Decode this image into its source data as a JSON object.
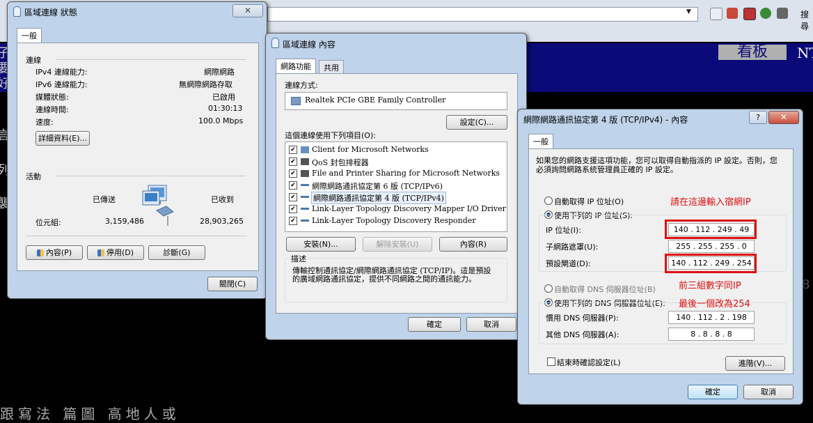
{
  "browser": {
    "search_label": "搜尋"
  },
  "background": {
    "board_label": "看板",
    "board_suffix": "NT",
    "left_glyphs": [
      "子",
      "要",
      "好",
      "言",
      "列",
      "襲"
    ],
    "bottom_text": "跟寫法   篇圖    高地人或",
    "right_char": "8"
  },
  "status_window": {
    "title": "區域連線 狀態",
    "close": "✕",
    "tab": "一般",
    "connection_header": "連線",
    "rows": [
      {
        "label": "IPv4 連線能力:",
        "value": "網際網路"
      },
      {
        "label": "IPv6 連線能力:",
        "value": "無網際網路存取"
      },
      {
        "label": "媒體狀態:",
        "value": "已啟用"
      },
      {
        "label": "連線時間:",
        "value": "01:30:13"
      },
      {
        "label": "速度:",
        "value": "100.0 Mbps"
      }
    ],
    "details_button": "詳細資料(E)...",
    "activity_header": "活動",
    "sent_label": "已傳送",
    "received_label": "已收到",
    "bytes_label": "位元組:",
    "bytes_sent": "3,159,486",
    "bytes_received": "28,903,265",
    "properties_button": "內容(P)",
    "disable_button": "停用(D)",
    "diagnose_button": "診斷(G)",
    "close_button": "關閉(C)"
  },
  "props_window": {
    "title": "區域連線 內容",
    "tabs": [
      "網路功能",
      "共用"
    ],
    "connect_using_label": "連線方式:",
    "adapter": "Realtek PCIe GBE Family Controller",
    "configure_button": "設定(C)...",
    "items_label": "這個連線使用下列項目(O):",
    "items": [
      {
        "label": "Client for Microsoft Networks",
        "checked": true
      },
      {
        "label": "QoS 封包排程器",
        "checked": true
      },
      {
        "label": "File and Printer Sharing for Microsoft Networks",
        "checked": true
      },
      {
        "label": "網際網路通訊協定第 6 版 (TCP/IPv6)",
        "checked": true
      },
      {
        "label": "網際網路通訊協定第 4 版 (TCP/IPv4)",
        "checked": true,
        "selected": true
      },
      {
        "label": "Link-Layer Topology Discovery Mapper I/O Driver",
        "checked": true
      },
      {
        "label": "Link-Layer Topology Discovery Responder",
        "checked": true
      }
    ],
    "install_button": "安裝(N)...",
    "uninstall_button": "解除安裝(U)",
    "properties_button": "內容(R)",
    "description_label": "描述",
    "description": "傳輸控制通訊協定/網際網路通訊協定 (TCP/IP)。這是預設的廣域網路通訊協定，提供不同網路之間的通訊能力。",
    "ok_button": "確定",
    "cancel_button": "取消"
  },
  "ipv4_window": {
    "title": "網際網路通訊協定第 4 版 (TCP/IPv4) - 內容",
    "help": "?",
    "close": "✕",
    "tab": "一般",
    "intro": "如果您的網路支援這項功能，您可以取得自動指派的 IP 設定。否則，您必須詢問網路系統管理員正確的 IP 設定。",
    "auto_ip": "自動取得 IP 位址(O)",
    "use_ip": "使用下列的 IP 位址(S):",
    "ip_label": "IP 位址(I):",
    "ip_value": "140 . 112 . 249 . 49",
    "mask_label": "子網路遮罩(U):",
    "mask_value": "255 . 255 . 255 . 0",
    "gateway_label": "預設閘道(D):",
    "gateway_value": "140 . 112 . 249 . 254",
    "auto_dns": "自動取得 DNS 伺服器位址(B)",
    "use_dns": "使用下列的 DNS 伺服器位址(E):",
    "pref_dns_label": "慣用 DNS 伺服器(P):",
    "pref_dns_value": "140 . 112 . 2 . 198",
    "alt_dns_label": "其他 DNS 伺服器(A):",
    "alt_dns_value": "8 . 8 . 8 . 8",
    "validate_label": "結束時確認設定(L)",
    "advanced_button": "進階(V)...",
    "ok_button": "確定",
    "cancel_button": "取消"
  },
  "annotations": {
    "note1": "請在這邊輸入宿網IP",
    "note2": "前三組數字同IP",
    "note3": "最後一個改為254"
  },
  "colors": {
    "annotation": "#e01010",
    "navy": "#0a0a78"
  }
}
